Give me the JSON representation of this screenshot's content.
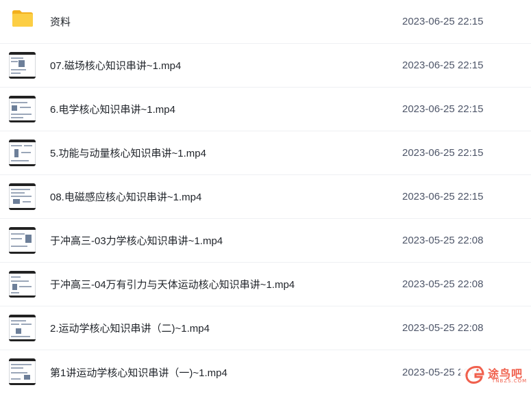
{
  "files": [
    {
      "name": "资料",
      "date": "2023-06-25 22:15",
      "type": "folder",
      "icon": "folder-icon"
    },
    {
      "name": "07.磁场核心知识串讲~1.mp4",
      "date": "2023-06-25 22:15",
      "type": "video",
      "icon": "video-thumbnail"
    },
    {
      "name": "6.电学核心知识串讲~1.mp4",
      "date": "2023-06-25 22:15",
      "type": "video",
      "icon": "video-thumbnail"
    },
    {
      "name": "5.功能与动量核心知识串讲~1.mp4",
      "date": "2023-06-25 22:15",
      "type": "video",
      "icon": "video-thumbnail"
    },
    {
      "name": "08.电磁感应核心知识串讲~1.mp4",
      "date": "2023-06-25 22:15",
      "type": "video",
      "icon": "video-thumbnail"
    },
    {
      "name": "于冲高三-03力学核心知识串讲~1.mp4",
      "date": "2023-05-25 22:08",
      "type": "video",
      "icon": "video-thumbnail"
    },
    {
      "name": "于冲高三-04万有引力与天体运动核心知识串讲~1.mp4",
      "date": "2023-05-25 22:08",
      "type": "video",
      "icon": "video-thumbnail"
    },
    {
      "name": "2.运动学核心知识串讲（二)~1.mp4",
      "date": "2023-05-25 22:08",
      "type": "video",
      "icon": "video-thumbnail"
    },
    {
      "name": "第1讲运动学核心知识串讲（一)~1.mp4",
      "date": "2023-05-25 22:08",
      "type": "video",
      "icon": "video-thumbnail"
    }
  ],
  "watermark": {
    "text": "途鸟吧",
    "sub": "TNBZS.COM",
    "color": "#f0604d"
  },
  "colors": {
    "folder": "#f7c232",
    "name_text": "#1f2329",
    "date_text": "#4e5669",
    "divider": "#eef0f3"
  }
}
